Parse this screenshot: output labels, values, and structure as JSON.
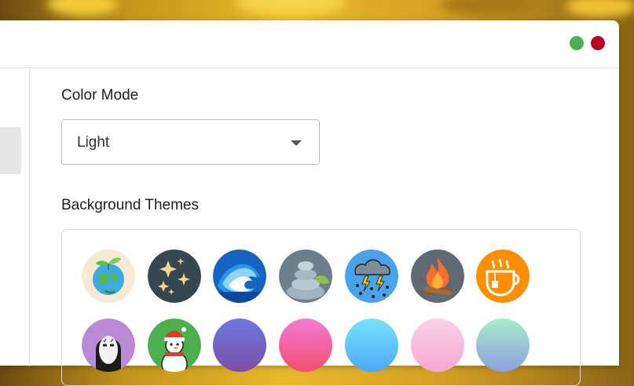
{
  "color_mode": {
    "label": "Color Mode",
    "value": "Light"
  },
  "background_themes": {
    "label": "Background Themes",
    "items": [
      {
        "icon": "globe-plant-icon"
      },
      {
        "icon": "stars-night-icon"
      },
      {
        "icon": "ocean-wave-icon"
      },
      {
        "icon": "zen-stones-icon"
      },
      {
        "icon": "thunderstorm-icon"
      },
      {
        "icon": "campfire-icon"
      },
      {
        "icon": "tea-cup-icon"
      },
      {
        "icon": "mask-face-icon"
      },
      {
        "icon": "snowman-icon"
      },
      {
        "icon": "gradient-purple",
        "colors": [
          "#6b78e0",
          "#7b4fa8"
        ]
      },
      {
        "icon": "gradient-pink-red",
        "colors": [
          "#f47bd0",
          "#f0506e"
        ]
      },
      {
        "icon": "gradient-cyan-blue",
        "colors": [
          "#77e4fb",
          "#4fa7f8"
        ]
      },
      {
        "icon": "gradient-pastel-pink",
        "colors": [
          "#fbd0ec",
          "#f6a9cf"
        ]
      },
      {
        "icon": "gradient-mint-blue",
        "colors": [
          "#a7ecc8",
          "#8e9fe0"
        ]
      }
    ]
  },
  "window_controls": {
    "maximize_color": "#4caf50",
    "close_color": "#b8001f"
  }
}
